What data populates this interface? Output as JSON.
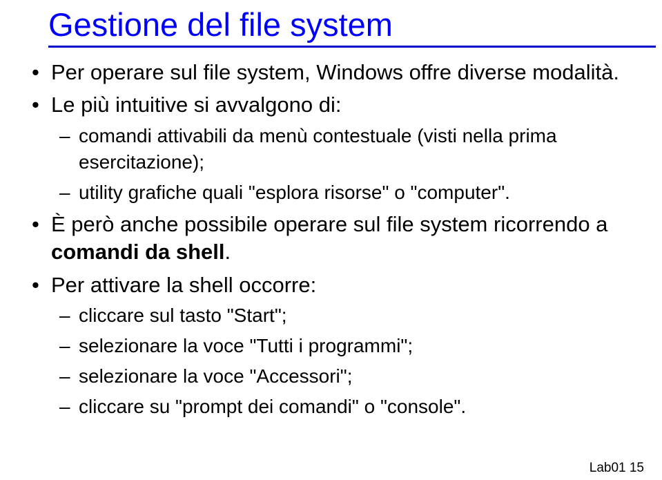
{
  "title": "Gestione del file system",
  "bullets": {
    "b1": "Per operare sul file system, Windows offre diverse modalità.",
    "b2": "Le più intuitive si avvalgono di:",
    "b2_sub": {
      "s1": "comandi attivabili da menù contestuale (visti nella prima esercitazione);",
      "s2": "utility grafiche quali \"esplora risorse\" o \"computer\"."
    },
    "b3_pre": "È però anche possibile operare sul file system ricorrendo a ",
    "b3_bold": "comandi da shell",
    "b3_post": ".",
    "b4": "Per attivare la shell occorre:",
    "b4_sub": {
      "s1": "cliccare sul tasto \"Start\";",
      "s2": "selezionare la voce \"Tutti i programmi\";",
      "s3": "selezionare la voce \"Accessori\";",
      "s4": "cliccare su \"prompt dei comandi\" o \"console\"."
    }
  },
  "footer": "Lab01  15"
}
